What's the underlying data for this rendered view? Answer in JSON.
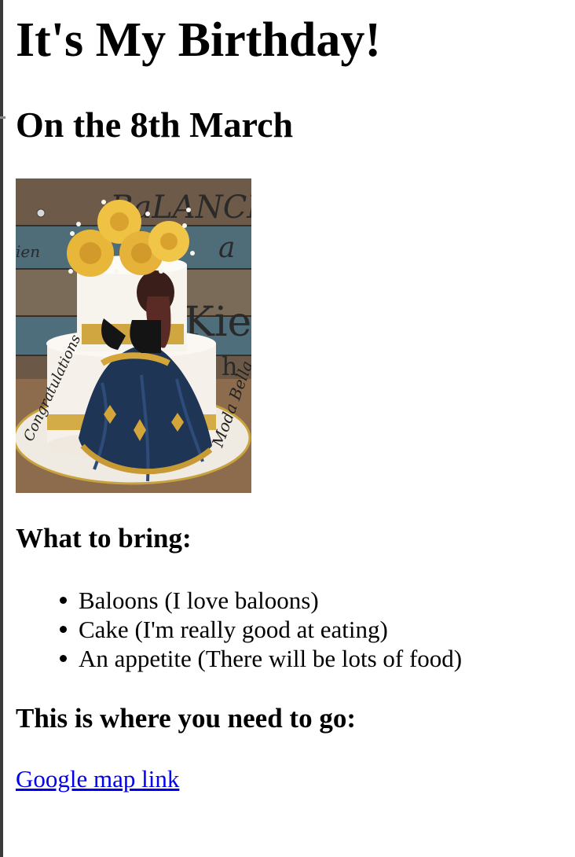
{
  "page": {
    "title": "It's My Birthday!",
    "date_heading": "On the 8th March"
  },
  "image": {
    "alt": "cake",
    "visible_lettering": [
      "BaLANCE",
      "a",
      "Kie",
      "h",
      "Congratulations",
      "Moda Bella"
    ]
  },
  "bring": {
    "heading": "What to bring:",
    "items": [
      "Baloons (I love baloons)",
      "Cake (I'm really good at eating)",
      "An appetite (There will be lots of food)"
    ]
  },
  "directions": {
    "heading": "This is where you need to go:",
    "link_label": "Google map link"
  },
  "colors": {
    "link": "#0000ee",
    "text": "#000000",
    "background": "#ffffff",
    "left_edge": "#3a3a3a"
  }
}
